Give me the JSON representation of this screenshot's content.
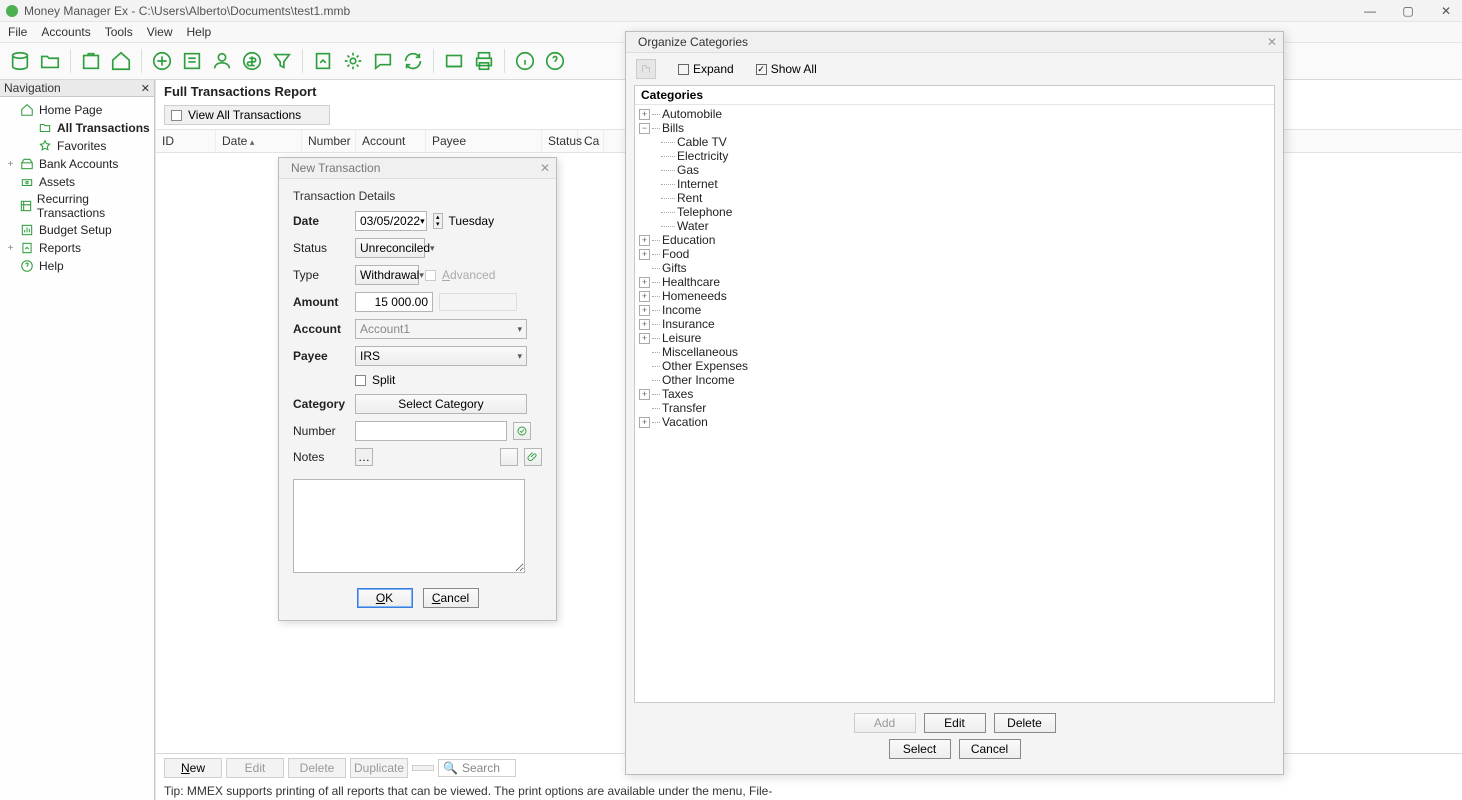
{
  "window": {
    "title": "Money Manager Ex - C:\\Users\\Alberto\\Documents\\test1.mmb"
  },
  "menus": [
    "File",
    "Accounts",
    "Tools",
    "View",
    "Help"
  ],
  "nav": {
    "header": "Navigation",
    "items": [
      {
        "label": "Home Page",
        "expand": ""
      },
      {
        "label": "All Transactions",
        "expand": "",
        "selected": true,
        "child": true
      },
      {
        "label": "Favorites",
        "expand": "",
        "child": true
      },
      {
        "label": "Bank Accounts",
        "expand": "+"
      },
      {
        "label": "Assets",
        "expand": ""
      },
      {
        "label": "Recurring Transactions",
        "expand": ""
      },
      {
        "label": "Budget Setup",
        "expand": ""
      },
      {
        "label": "Reports",
        "expand": "+"
      },
      {
        "label": "Help",
        "expand": ""
      }
    ]
  },
  "report": {
    "title": "Full Transactions Report",
    "view_toggle": "View All Transactions",
    "columns": [
      "ID",
      "Date",
      "Number",
      "Account",
      "Payee",
      "Status",
      "Ca"
    ]
  },
  "bottom": {
    "new": "New",
    "edit": "Edit",
    "delete": "Delete",
    "duplicate": "Duplicate",
    "search_placeholder": "Search"
  },
  "tip": "Tip: MMEX supports printing of all reports that can be viewed. The print options are available under the menu, File-",
  "nt_dialog": {
    "title": "New Transaction",
    "section": "Transaction Details",
    "fields": {
      "date_label": "Date",
      "date_value": "03/05/2022",
      "weekday": "Tuesday",
      "status_label": "Status",
      "status_value": "Unreconciled",
      "type_label": "Type",
      "type_value": "Withdrawal",
      "advanced": "Advanced",
      "amount_label": "Amount",
      "amount_value": "15 000.00",
      "account_label": "Account",
      "account_value": "Account1",
      "payee_label": "Payee",
      "payee_value": "IRS",
      "split": "Split",
      "category_label": "Category",
      "category_btn": "Select Category",
      "number_label": "Number",
      "notes_label": "Notes"
    },
    "ok": "OK",
    "cancel": "Cancel"
  },
  "oc_dialog": {
    "title": "Organize Categories",
    "expand": "Expand",
    "show_all": "Show All",
    "header": "Categories",
    "tree": [
      {
        "label": "Automobile",
        "exp": "+"
      },
      {
        "label": "Bills",
        "exp": "−",
        "children": [
          "Cable TV",
          "Electricity",
          "Gas",
          "Internet",
          "Rent",
          "Telephone",
          "Water"
        ]
      },
      {
        "label": "Education",
        "exp": "+"
      },
      {
        "label": "Food",
        "exp": "+"
      },
      {
        "label": "Gifts",
        "exp": ""
      },
      {
        "label": "Healthcare",
        "exp": "+"
      },
      {
        "label": "Homeneeds",
        "exp": "+"
      },
      {
        "label": "Income",
        "exp": "+"
      },
      {
        "label": "Insurance",
        "exp": "+"
      },
      {
        "label": "Leisure",
        "exp": "+"
      },
      {
        "label": "Miscellaneous",
        "exp": ""
      },
      {
        "label": "Other Expenses",
        "exp": ""
      },
      {
        "label": "Other Income",
        "exp": ""
      },
      {
        "label": "Taxes",
        "exp": "+"
      },
      {
        "label": "Transfer",
        "exp": ""
      },
      {
        "label": "Vacation",
        "exp": "+"
      }
    ],
    "add": "Add",
    "edit": "Edit",
    "delete": "Delete",
    "select": "Select",
    "cancel": "Cancel"
  }
}
